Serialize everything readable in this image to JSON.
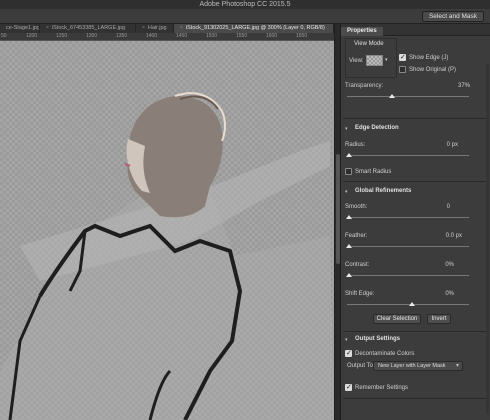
{
  "app": {
    "title": "Adobe Photoshop CC 2015.5"
  },
  "options_bar": {
    "select_and_mask": "Select and Mask"
  },
  "tabs": [
    {
      "label": "ce-Stage1.jpg",
      "active": false
    },
    {
      "label": "iStock_67453385_LARGE.jpg",
      "active": false
    },
    {
      "label": "Hair.jpg",
      "active": false
    },
    {
      "label": "iStock_91302025_LARGE.jpg @ 300% (Layer 0, RGB/8)",
      "active": true
    }
  ],
  "ruler": {
    "ticks": [
      "50",
      "1200",
      "1250",
      "1300",
      "1350",
      "1400",
      "1450",
      "1500",
      "1550",
      "1600",
      "1650"
    ]
  },
  "properties": {
    "panel_title": "Properties",
    "view_mode": {
      "heading": "View Mode",
      "view_label": "View:",
      "show_edge": "Show Edge (J)",
      "show_edge_checked": true,
      "show_original": "Show Original (P)",
      "show_original_checked": false
    },
    "transparency": {
      "label": "Transparency:",
      "value": "37%",
      "fraction": 0.37
    },
    "edge_detection": {
      "heading": "Edge Detection",
      "radius_label": "Radius:",
      "radius_value": "0 px",
      "smart_radius": "Smart Radius",
      "smart_radius_checked": false
    },
    "global_refinements": {
      "heading": "Global Refinements",
      "smooth_label": "Smooth:",
      "smooth_value": "0",
      "feather_label": "Feather:",
      "feather_value": "0.0 px",
      "contrast_label": "Contrast:",
      "contrast_value": "0%",
      "shift_edge_label": "Shift Edge:",
      "shift_edge_value": "0%",
      "clear_selection": "Clear Selection",
      "invert": "Invert"
    },
    "output_settings": {
      "heading": "Output Settings",
      "decontaminate": "Decontaminate Colors",
      "decontaminate_checked": true,
      "output_to_label": "Output To:",
      "output_to_value": "New Layer with Layer Mask",
      "remember": "Remember Settings",
      "remember_checked": true
    }
  }
}
